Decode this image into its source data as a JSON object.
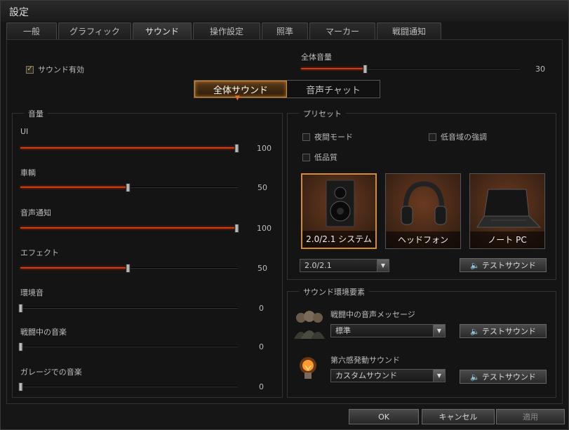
{
  "window": {
    "title": "設定"
  },
  "tabs": [
    {
      "label": "一般"
    },
    {
      "label": "グラフィック"
    },
    {
      "label": "サウンド"
    },
    {
      "label": "操作設定"
    },
    {
      "label": "照準"
    },
    {
      "label": "マーカー"
    },
    {
      "label": "戦闘通知"
    }
  ],
  "sound_enabled": {
    "label": "サウンド有効",
    "checked": true
  },
  "master_volume": {
    "label": "全体音量",
    "value": "30"
  },
  "mode_switch": {
    "options": [
      "全体サウンド",
      "音声チャット"
    ],
    "selected": 0
  },
  "volume_group": {
    "title": "音量",
    "sliders": [
      {
        "label": "UI",
        "value": "100"
      },
      {
        "label": "車輌",
        "value": "50"
      },
      {
        "label": "音声通知",
        "value": "100"
      },
      {
        "label": "エフェクト",
        "value": "50"
      },
      {
        "label": "環境音",
        "value": "0"
      },
      {
        "label": "戦闘中の音楽",
        "value": "0"
      },
      {
        "label": "ガレージでの音楽",
        "value": "0"
      }
    ]
  },
  "preset_group": {
    "title": "プリセット",
    "night_mode": {
      "label": "夜間モード",
      "checked": false
    },
    "bass_boost": {
      "label": "低音域の強調",
      "checked": false
    },
    "low_quality": {
      "label": "低品質",
      "checked": false
    },
    "devices": [
      {
        "label": "2.0/2.1 システム",
        "icon": "speaker-icon"
      },
      {
        "label": "ヘッドフォン",
        "icon": "headphones-icon"
      },
      {
        "label": "ノート PC",
        "icon": "laptop-icon"
      }
    ],
    "device_select": "2.0/2.1",
    "test_sound_label": "テストサウンド"
  },
  "env_group": {
    "title": "サウンド環境要素",
    "voice": {
      "label": "戦闘中の音声メッセージ",
      "value": "標準",
      "icon": "crew-icon"
    },
    "sixth_sense": {
      "label": "第六感発動サウンド",
      "value": "カスタムサウンド",
      "icon": "lightbulb-icon"
    },
    "test_sound_label": "テストサウンド"
  },
  "footer": {
    "ok": "OK",
    "cancel": "キャンセル",
    "apply": "適用"
  },
  "colors": {
    "accent": "#d88a30",
    "slider_fill": "#c03010",
    "background": "#141414"
  }
}
